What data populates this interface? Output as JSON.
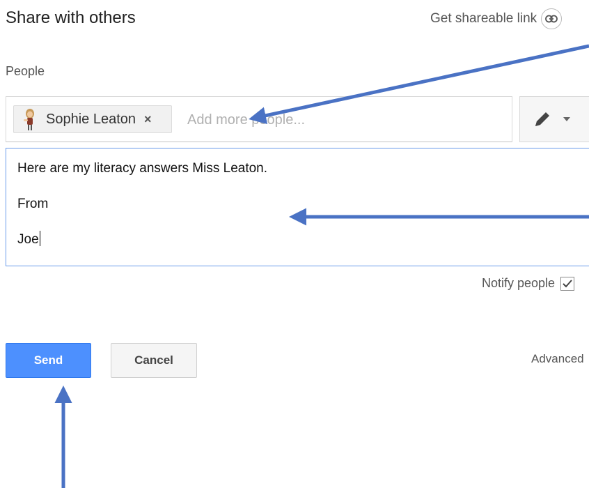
{
  "dialog": {
    "title": "Share with others",
    "share_link_label": "Get shareable link",
    "share_link_icon": "link-icon"
  },
  "people": {
    "label": "People",
    "recipients": [
      {
        "name": "Sophie Leaton",
        "remove_icon": "×",
        "avatar": "avatar-icon"
      }
    ],
    "input_placeholder": "Add more people...",
    "permission_icon": "pencil-icon",
    "permission_caret_icon": "chevron-down-icon"
  },
  "message": {
    "lines": [
      "Here are my literacy answers Miss Leaton.",
      "From",
      "Joe"
    ]
  },
  "notify": {
    "label": "Notify people",
    "checked": true
  },
  "actions": {
    "send_label": "Send",
    "cancel_label": "Cancel",
    "advanced_label": "Advanced"
  },
  "colors": {
    "send_button": "#4d90fe",
    "focus_border": "#6a9bea",
    "annotation_arrow": "#4a72c4"
  }
}
